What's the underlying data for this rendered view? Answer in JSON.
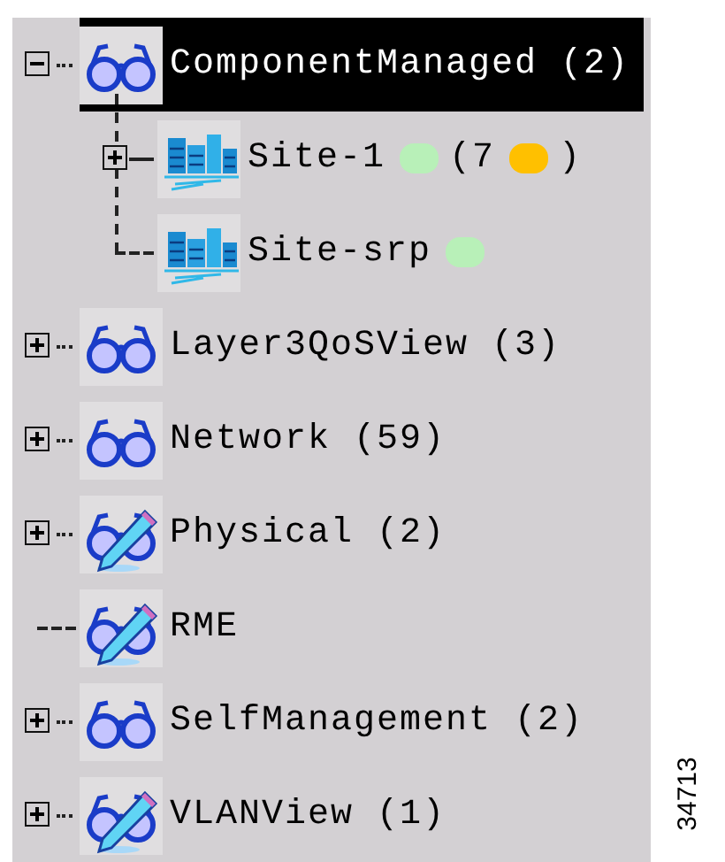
{
  "tree": [
    {
      "label": "ComponentManaged (2)",
      "kind": "glasses",
      "expanded": true,
      "selected": true,
      "children": [
        {
          "label": "Site-1",
          "kind": "buildings",
          "expanded": false,
          "selected": false,
          "after": [
            {
              "kind": "dot",
              "color": "#b8f0b8"
            },
            {
              "kind": "text",
              "text": "(7"
            },
            {
              "kind": "dot",
              "color": "#ffc000"
            },
            {
              "kind": "text",
              "text": ")"
            }
          ]
        },
        {
          "label": "Site-srp",
          "kind": "buildings",
          "selected": false,
          "after": [
            {
              "kind": "dot",
              "color": "#b8f0b8"
            }
          ]
        }
      ]
    },
    {
      "label": "Layer3QoSView (3)",
      "kind": "glasses",
      "expanded": false,
      "selected": false
    },
    {
      "label": "Network (59)",
      "kind": "glasses",
      "expanded": false,
      "selected": false
    },
    {
      "label": "Physical (2)",
      "kind": "glasses-pen",
      "expanded": false,
      "selected": false
    },
    {
      "label": "RME",
      "kind": "glasses-pen",
      "selected": false
    },
    {
      "label": "SelfManagement (2)",
      "kind": "glasses",
      "expanded": false,
      "selected": false
    },
    {
      "label": "VLANView (1)",
      "kind": "glasses-pen",
      "expanded": false,
      "selected": false
    }
  ],
  "figure_number": "34713"
}
